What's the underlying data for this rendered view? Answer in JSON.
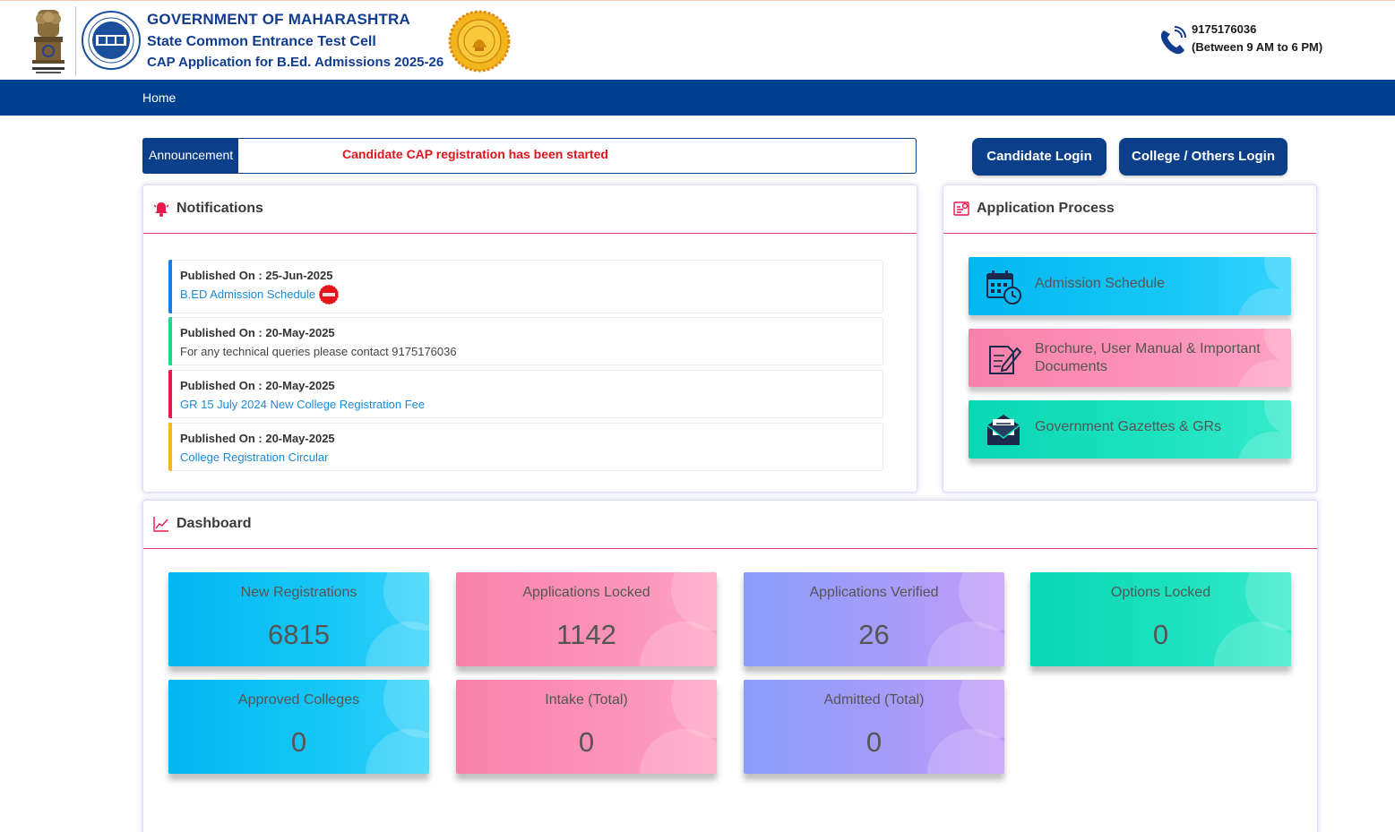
{
  "header": {
    "title1": "GOVERNMENT OF MAHARASHTRA",
    "title2": "State Common Entrance Test Cell",
    "title3": "CAP Application for B.Ed. Admissions 2025-26",
    "phone": "9175176036",
    "phone_hours": "(Between 9 AM to 6 PM)"
  },
  "nav": {
    "home": "Home"
  },
  "announcement": {
    "label": "Announcement",
    "text": "Candidate CAP registration has been started"
  },
  "login": {
    "candidate": "Candidate Login",
    "college": "College / Others Login"
  },
  "notifications": {
    "title": "Notifications",
    "items": [
      {
        "published": "Published On : 25-Jun-2025",
        "text": "B.ED Admission Schedule",
        "color": "#1e7fe0"
      },
      {
        "published": "Published On : 20-May-2025",
        "text": "For any technical queries please contact 9175176036",
        "color": "#22d38a"
      },
      {
        "published": "Published On : 20-May-2025",
        "text": "GR 15 July 2024 New College Registration Fee",
        "color": "#e8194c"
      },
      {
        "published": "Published On : 20-May-2025",
        "text": "College Registration Circular",
        "color": "#f2b81d"
      }
    ]
  },
  "application_process": {
    "title": "Application Process",
    "items": [
      {
        "label": "Admission Schedule",
        "icon": "calendar-clock-icon"
      },
      {
        "label": "Brochure, User Manual & Important",
        "label2": "Documents",
        "icon": "document-pen-icon"
      },
      {
        "label": "Government Gazettes & GRs",
        "icon": "envelope-letter-icon"
      }
    ]
  },
  "dashboard": {
    "title": "Dashboard",
    "stats": [
      {
        "label": "New Registrations",
        "value": "6815"
      },
      {
        "label": "Applications Locked",
        "value": "1142"
      },
      {
        "label": "Applications Verified",
        "value": "26"
      },
      {
        "label": "Options Locked",
        "value": "0"
      },
      {
        "label": "Approved Colleges",
        "value": "0"
      },
      {
        "label": "Intake (Total)",
        "value": "0"
      },
      {
        "label": "Admitted (Total)",
        "value": "0"
      }
    ]
  }
}
